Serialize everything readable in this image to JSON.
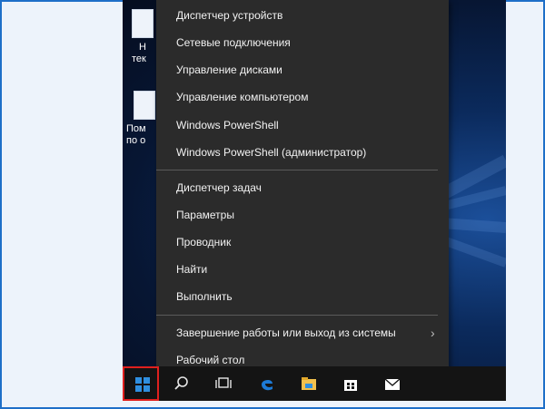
{
  "desktop": {
    "icons": [
      {
        "label_line1": "Н",
        "label_line2": "тек"
      },
      {
        "label_line1": "Пом",
        "label_line2": "по о"
      }
    ]
  },
  "menu": {
    "group1": [
      {
        "label": "Диспетчер устройств"
      },
      {
        "label": "Сетевые подключения"
      },
      {
        "label": "Управление дисками"
      },
      {
        "label": "Управление компьютером"
      },
      {
        "label": "Windows PowerShell"
      },
      {
        "label": "Windows PowerShell (администратор)"
      }
    ],
    "group2": [
      {
        "label": "Диспетчер задач"
      },
      {
        "label": "Параметры"
      },
      {
        "label": "Проводник"
      },
      {
        "label": "Найти"
      },
      {
        "label": "Выполнить"
      }
    ],
    "group3": [
      {
        "label": "Завершение работы или выход из системы",
        "has_submenu": true
      },
      {
        "label": "Рабочий стол"
      }
    ],
    "submenu_chevron": "›"
  },
  "taskbar": {
    "start_icon": "windows-logo-icon",
    "icons": [
      "search-icon",
      "task-view-icon",
      "edge-icon",
      "file-explorer-icon",
      "store-icon",
      "mail-icon"
    ]
  },
  "colors": {
    "menu_bg": "#2b2b2b",
    "taskbar_bg": "#141414",
    "highlight_border": "#e0201e",
    "windows_blue": "#2f8fe0",
    "frame_border": "#1e6fc8"
  }
}
